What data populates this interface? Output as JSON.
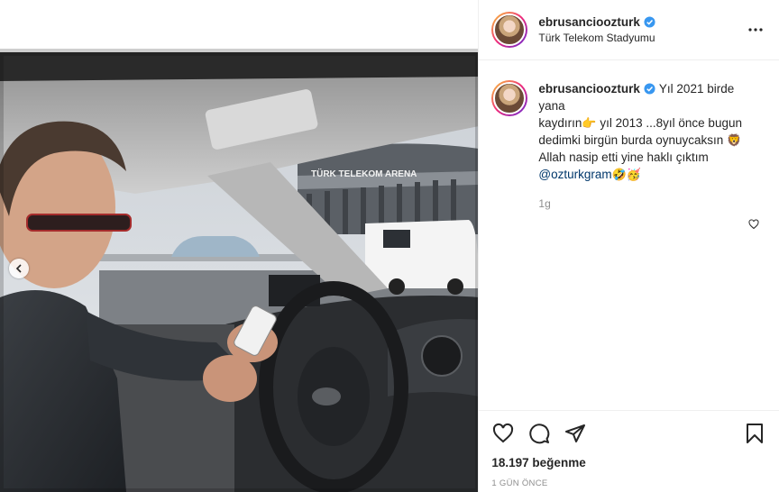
{
  "post": {
    "author": {
      "username": "ebrusancioozturk",
      "location": "Türk Telekom Stadyumu",
      "verified": true
    },
    "photo": {
      "sign_text": "TÜRK TELEKOM ARENA",
      "carousel_prev_icon": "chevron-left-icon"
    },
    "caption": {
      "username": "ebrusancioozturk",
      "line1": "Yıl 2021 birde yana",
      "line2": "kaydırın",
      "line2_emoji": "👉",
      "line2_rest": " yıl 2013 ...8yıl önce bugun",
      "line3": "dedimki birgün burda oynuycaksın",
      "line3_emoji": "🦁",
      "line4": "Allah nasip etti yine haklı çıktım",
      "mention": "@ozturkgram",
      "mention_emojis": "🤣🥳",
      "time_ago": "1g"
    },
    "actions": {
      "like_icon": "heart-icon",
      "comment_icon": "comment-icon",
      "share_icon": "share-icon",
      "save_icon": "bookmark-icon",
      "likes_count": "18.197 beğenme",
      "date": "1 GÜN ÖNCE"
    },
    "colors": {
      "accent_blue": "#0095f6",
      "mention_blue": "#00376b",
      "muted_text": "#8e8e8e",
      "border": "#efefef"
    }
  }
}
